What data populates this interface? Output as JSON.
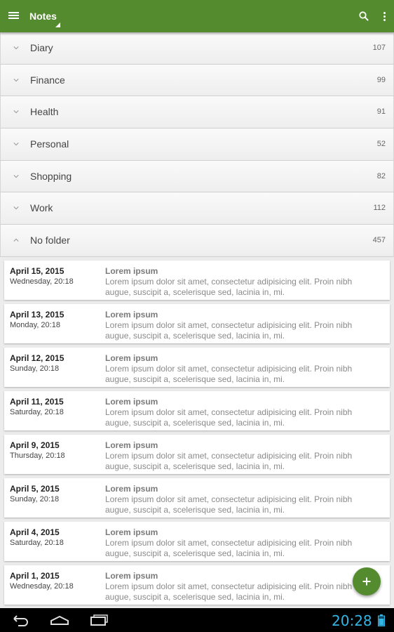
{
  "app": {
    "title": "Notes",
    "accent_color": "#558b2f",
    "icons": [
      "hamburger-menu-icon",
      "search-icon",
      "overflow-menu-icon",
      "add-icon"
    ]
  },
  "folders": [
    {
      "name": "Diary",
      "count": "107",
      "expanded": false
    },
    {
      "name": "Finance",
      "count": "99",
      "expanded": false
    },
    {
      "name": "Health",
      "count": "91",
      "expanded": false
    },
    {
      "name": "Personal",
      "count": "52",
      "expanded": false
    },
    {
      "name": "Shopping",
      "count": "82",
      "expanded": false
    },
    {
      "name": "Work",
      "count": "112",
      "expanded": false
    },
    {
      "name": "No folder",
      "count": "457",
      "expanded": true
    }
  ],
  "notes": [
    {
      "date": "April 15, 2015",
      "day": "Wednesday, 20:18",
      "title": "Lorem ipsum",
      "body": "Lorem ipsum dolor sit amet, consectetur adipisicing elit. Proin nibh augue, suscipit a, scelerisque sed, lacinia in, mi."
    },
    {
      "date": "April 13, 2015",
      "day": "Monday, 20:18",
      "title": "Lorem ipsum",
      "body": "Lorem ipsum dolor sit amet, consectetur adipisicing elit. Proin nibh augue, suscipit a, scelerisque sed, lacinia in, mi."
    },
    {
      "date": "April 12, 2015",
      "day": "Sunday, 20:18",
      "title": "Lorem ipsum",
      "body": "Lorem ipsum dolor sit amet, consectetur adipisicing elit. Proin nibh augue, suscipit a, scelerisque sed, lacinia in, mi."
    },
    {
      "date": "April 11, 2015",
      "day": "Saturday, 20:18",
      "title": "Lorem ipsum",
      "body": "Lorem ipsum dolor sit amet, consectetur adipisicing elit. Proin nibh augue, suscipit a, scelerisque sed, lacinia in, mi."
    },
    {
      "date": "April 9, 2015",
      "day": "Thursday, 20:18",
      "title": "Lorem ipsum",
      "body": "Lorem ipsum dolor sit amet, consectetur adipisicing elit. Proin nibh augue, suscipit a, scelerisque sed, lacinia in, mi."
    },
    {
      "date": "April 5, 2015",
      "day": "Sunday, 20:18",
      "title": "Lorem ipsum",
      "body": "Lorem ipsum dolor sit amet, consectetur adipisicing elit. Proin nibh augue, suscipit a, scelerisque sed, lacinia in, mi."
    },
    {
      "date": "April 4, 2015",
      "day": "Saturday, 20:18",
      "title": "Lorem ipsum",
      "body": "Lorem ipsum dolor sit amet, consectetur adipisicing elit. Proin nibh augue, suscipit a, scelerisque sed, lacinia in, mi."
    },
    {
      "date": "April 1, 2015",
      "day": "Wednesday, 20:18",
      "title": "Lorem ipsum",
      "body": "Lorem ipsum dolor sit amet, consectetur adipisicing elit. Proin nibh augue, suscipit a, scelerisque sed, lacinia in, mi."
    }
  ],
  "system_bar": {
    "time": "20:28",
    "clock_color": "#33b5e5",
    "icons": [
      "back-icon",
      "home-icon",
      "recent-apps-icon",
      "battery-icon"
    ]
  }
}
